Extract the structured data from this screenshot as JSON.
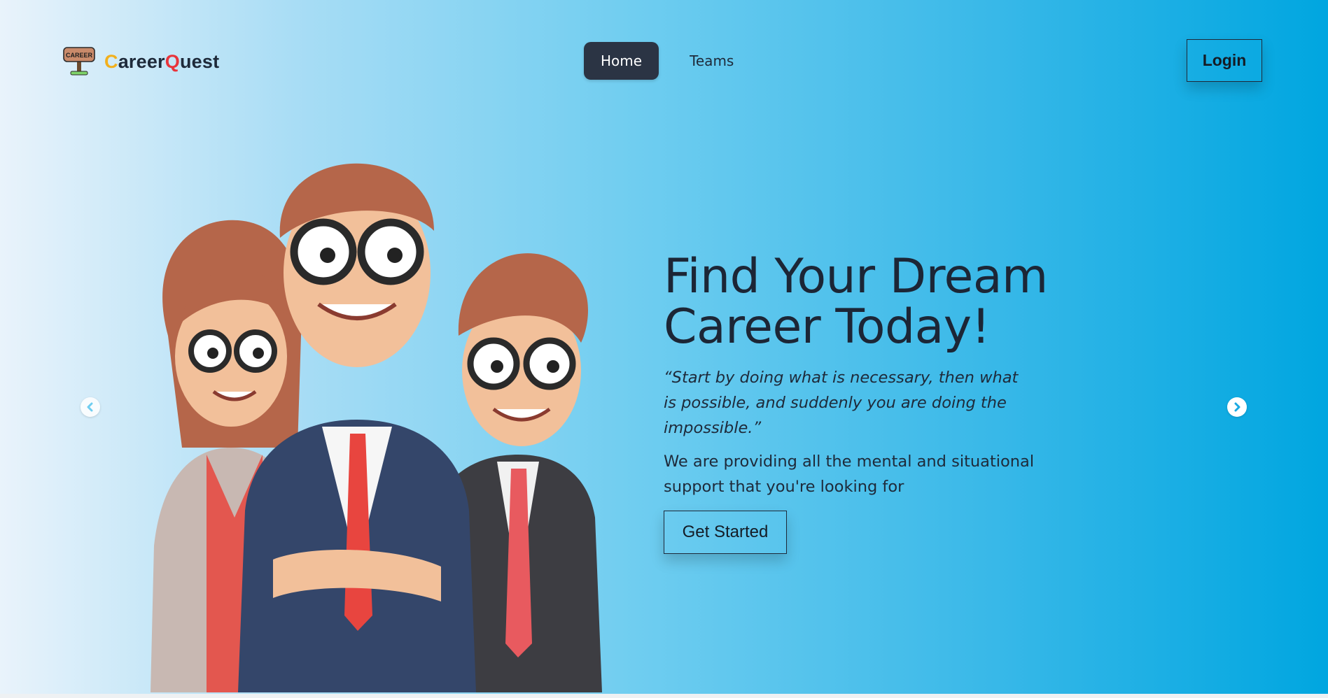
{
  "header": {
    "logo_sign_text": "CAREER",
    "brand_first_letter": "C",
    "brand_middle": "areer",
    "brand_second_letter": "Q",
    "brand_end": "uest",
    "nav": [
      {
        "label": "Home",
        "active": true
      },
      {
        "label": "Teams",
        "active": false
      }
    ],
    "login_label": "Login"
  },
  "hero": {
    "title_line1": "Find Your Dream",
    "title_line2": "Career Today!",
    "quote": "“Start by doing what is necessary, then what is possible, and suddenly you are doing the impossible.”",
    "support": "We are providing all the mental and situational support that you're looking for",
    "cta_label": "Get Started"
  },
  "carousel": {
    "prev_icon": "chevron-left-icon",
    "next_icon": "chevron-right-icon"
  },
  "colors": {
    "accent_dark": "#2b3444",
    "brand_yellow": "#f2b01e",
    "brand_red": "#e8343b",
    "bg_right": "#00a6e0"
  }
}
